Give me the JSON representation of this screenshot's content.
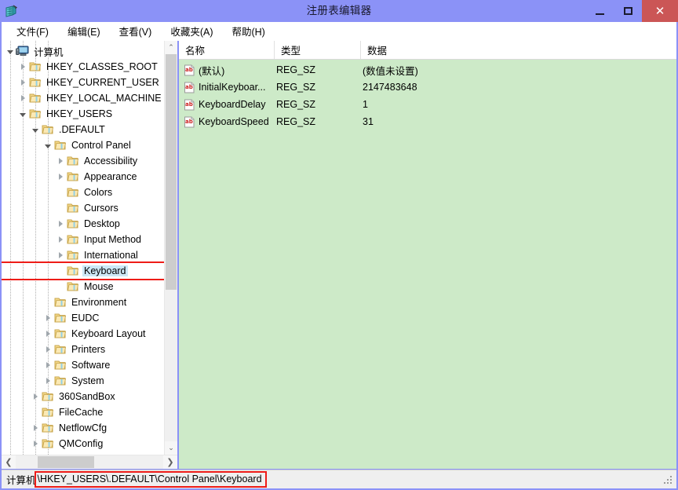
{
  "window": {
    "title": "注册表编辑器",
    "app_icon": "regedit-icon",
    "minimize_label": "最小化",
    "maximize_label": "最大化",
    "close_label": "关闭",
    "close_glyph": "✕",
    "accent_titlebar": "#8b92f7",
    "accent_close": "#cb5656"
  },
  "menubar": {
    "items": [
      {
        "label": "文件(F)",
        "name": "menu-file"
      },
      {
        "label": "编辑(E)",
        "name": "menu-edit"
      },
      {
        "label": "查看(V)",
        "name": "menu-view"
      },
      {
        "label": "收藏夹(A)",
        "name": "menu-favorites"
      },
      {
        "label": "帮助(H)",
        "name": "menu-help"
      }
    ]
  },
  "tree": {
    "root": {
      "label": "计算机",
      "icon": "computer-icon"
    },
    "nodes": [
      {
        "label": "HKEY_CLASSES_ROOT",
        "depth": 1,
        "state": "collapsed"
      },
      {
        "label": "HKEY_CURRENT_USER",
        "depth": 1,
        "state": "collapsed"
      },
      {
        "label": "HKEY_LOCAL_MACHINE",
        "depth": 1,
        "state": "collapsed"
      },
      {
        "label": "HKEY_USERS",
        "depth": 1,
        "state": "expanded"
      },
      {
        "label": ".DEFAULT",
        "depth": 2,
        "state": "expanded"
      },
      {
        "label": "Control Panel",
        "depth": 3,
        "state": "expanded"
      },
      {
        "label": "Accessibility",
        "depth": 4,
        "state": "collapsed"
      },
      {
        "label": "Appearance",
        "depth": 4,
        "state": "collapsed"
      },
      {
        "label": "Colors",
        "depth": 4,
        "state": "leaf"
      },
      {
        "label": "Cursors",
        "depth": 4,
        "state": "leaf"
      },
      {
        "label": "Desktop",
        "depth": 4,
        "state": "collapsed"
      },
      {
        "label": "Input Method",
        "depth": 4,
        "state": "collapsed"
      },
      {
        "label": "International",
        "depth": 4,
        "state": "collapsed"
      },
      {
        "label": "Keyboard",
        "depth": 4,
        "state": "leaf",
        "selected": true,
        "annotated": true
      },
      {
        "label": "Mouse",
        "depth": 4,
        "state": "leaf"
      },
      {
        "label": "Environment",
        "depth": 3,
        "state": "leaf"
      },
      {
        "label": "EUDC",
        "depth": 3,
        "state": "collapsed"
      },
      {
        "label": "Keyboard Layout",
        "depth": 3,
        "state": "collapsed"
      },
      {
        "label": "Printers",
        "depth": 3,
        "state": "collapsed"
      },
      {
        "label": "Software",
        "depth": 3,
        "state": "collapsed"
      },
      {
        "label": "System",
        "depth": 3,
        "state": "collapsed"
      },
      {
        "label": "360SandBox",
        "depth": 2,
        "state": "collapsed"
      },
      {
        "label": "FileCache",
        "depth": 2,
        "state": "leaf"
      },
      {
        "label": "NetflowCfg",
        "depth": 2,
        "state": "collapsed"
      },
      {
        "label": "QMConfig",
        "depth": 2,
        "state": "collapsed"
      }
    ],
    "scroll_up_glyph": "⌃",
    "scroll_down_glyph": "⌄",
    "scroll_left_glyph": "❮",
    "scroll_right_glyph": "❯"
  },
  "list": {
    "columns": [
      {
        "label": "名称",
        "name": "column-name"
      },
      {
        "label": "类型",
        "name": "column-type"
      },
      {
        "label": "数据",
        "name": "column-data"
      }
    ],
    "rows": [
      {
        "name": "(默认)",
        "type": "REG_SZ",
        "data": "(数值未设置)",
        "icon": "string-value-icon"
      },
      {
        "name": "InitialKeyboar...",
        "type": "REG_SZ",
        "data": "2147483648",
        "icon": "string-value-icon"
      },
      {
        "name": "KeyboardDelay",
        "type": "REG_SZ",
        "data": "1",
        "icon": "string-value-icon"
      },
      {
        "name": "KeyboardSpeed",
        "type": "REG_SZ",
        "data": "31",
        "icon": "string-value-icon"
      }
    ]
  },
  "statusbar": {
    "prefix": "计算机",
    "path": "\\HKEY_USERS\\.DEFAULT\\Control Panel\\Keyboard",
    "annotation_color": "#ee1c18"
  }
}
